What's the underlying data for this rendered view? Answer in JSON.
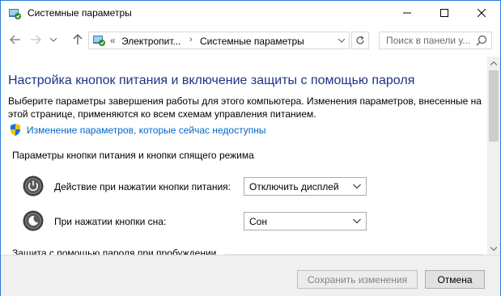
{
  "window": {
    "title": "Системные параметры",
    "controls": {
      "minimize": "minimize",
      "maximize": "maximize",
      "close": "close"
    }
  },
  "nav": {
    "breadcrumb_prefix": "«",
    "breadcrumb": [
      "Электропит...",
      "Системные параметры"
    ],
    "breadcrumb_separator": "›",
    "search_placeholder": "Поиск в панели у..."
  },
  "main": {
    "title": "Настройка кнопок питания и включение защиты с помощью пароля",
    "description": "Выберите параметры завершения работы для этого компьютера. Изменения параметров, внесенные на этой странице, применяются ко всем схемам управления питанием.",
    "admin_link": "Изменение параметров, которые сейчас недоступны",
    "power_section_title": "Параметры кнопки питания и кнопки спящего режима",
    "settings": [
      {
        "label": "Действие при нажатии кнопки питания:",
        "value": "Отключить дисплей",
        "icon": "power-button-icon"
      },
      {
        "label": "При нажатии кнопки сна:",
        "value": "Сон",
        "icon": "sleep-button-icon"
      }
    ],
    "password_section_title": "Защита с помощью пароля при пробуждении"
  },
  "footer": {
    "save_label": "Сохранить изменения",
    "cancel_label": "Отмена"
  },
  "colors": {
    "title_blue": "#1e3287",
    "link_blue": "#0066cc",
    "window_border": "#2b79d6"
  }
}
